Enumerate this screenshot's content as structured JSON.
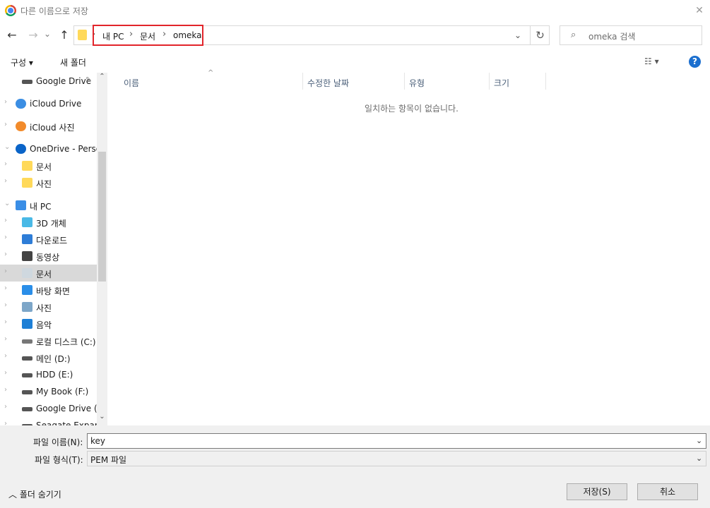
{
  "window": {
    "title": "다른 이름으로 저장",
    "close_glyph": "✕"
  },
  "nav": {
    "back": "←",
    "forward": "→",
    "recent": "⌄",
    "up": "↑",
    "refresh": "↻"
  },
  "address": {
    "crumbs": [
      "내 PC",
      "문서",
      "omeka"
    ],
    "separator": "›",
    "highlight_color": "#e2252b"
  },
  "search": {
    "placeholder": "omeka 검색",
    "icon": "search-icon"
  },
  "toolbar": {
    "organize": "구성 ▾",
    "new_folder": "새 폴더",
    "view": "☷ ▾",
    "help": "?"
  },
  "sidebar": {
    "items": [
      {
        "label": "Google Drive",
        "icon": "drive-icon",
        "pin": true
      },
      {
        "label": "iCloud Drive",
        "icon": "icloud-icon"
      },
      {
        "label": "iCloud 사진",
        "icon": "icloud-photos-icon"
      },
      {
        "label": "OneDrive - Perso",
        "icon": "onedrive-icon",
        "expanded": true
      },
      {
        "label": "문서",
        "icon": "folder-icon"
      },
      {
        "label": "사진",
        "icon": "folder-icon"
      },
      {
        "label": "내 PC",
        "icon": "pc-icon",
        "expanded": true
      },
      {
        "label": "3D 개체",
        "icon": "3d-objects-icon"
      },
      {
        "label": "다운로드",
        "icon": "download-icon"
      },
      {
        "label": "동영상",
        "icon": "video-icon"
      },
      {
        "label": "문서",
        "icon": "documents-icon",
        "selected": true
      },
      {
        "label": "바탕 화면",
        "icon": "desktop-icon"
      },
      {
        "label": "사진",
        "icon": "pictures-icon"
      },
      {
        "label": "음악",
        "icon": "music-icon"
      },
      {
        "label": "로컬 디스크 (C:)",
        "icon": "local-disk-icon"
      },
      {
        "label": "메인 (D:)",
        "icon": "drive-icon"
      },
      {
        "label": "HDD (E:)",
        "icon": "drive-icon"
      },
      {
        "label": "My Book (F:)",
        "icon": "drive-icon"
      },
      {
        "label": "Google Drive (G",
        "icon": "drive-icon"
      },
      {
        "label": "Seagate Expansi",
        "icon": "drive-icon"
      }
    ]
  },
  "filelist": {
    "columns": [
      "이름",
      "수정한 날짜",
      "유형",
      "크기"
    ],
    "empty_message": "일치하는 항목이 없습니다."
  },
  "form": {
    "filename_label": "파일 이름(N):",
    "filename_value": "key",
    "filetype_label": "파일 형식(T):",
    "filetype_value": "PEM 파일",
    "hide_folders": "폴더 숨기기",
    "save": "저장(S)",
    "cancel": "취소"
  }
}
